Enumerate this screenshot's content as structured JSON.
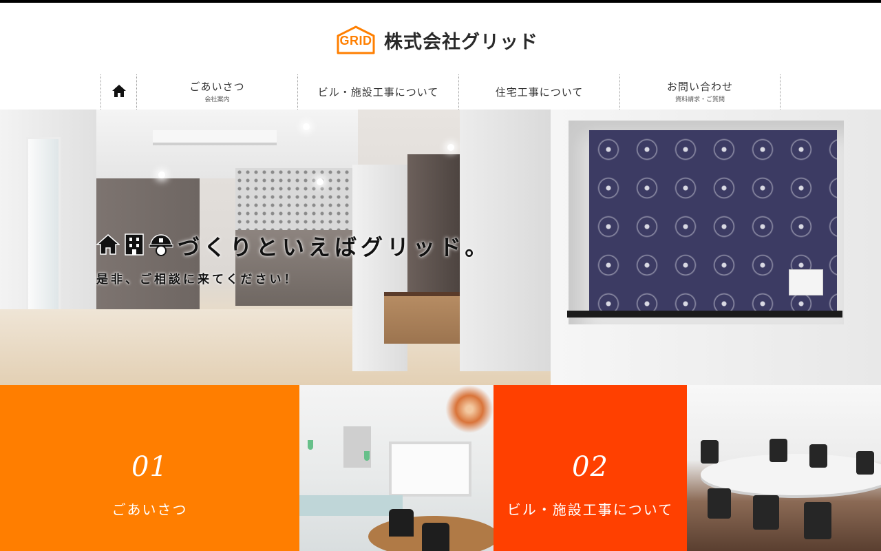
{
  "brand": {
    "logo_mark_text": "GRID",
    "company_name": "株式会社グリッド",
    "accent_color": "#ff7f00"
  },
  "nav": {
    "home_icon": "home-icon",
    "items": [
      {
        "label": "ごあいさつ",
        "sub": "会社案内"
      },
      {
        "label": "ビル・施設工事について",
        "sub": ""
      },
      {
        "label": "住宅工事について",
        "sub": ""
      },
      {
        "label": "お問い合わせ",
        "sub": "資料請求・ご質問"
      }
    ]
  },
  "hero": {
    "icons": [
      "house-icon",
      "building-icon",
      "helmet-icon"
    ],
    "title": "づくりといえばグリッド。",
    "subtitle": "是非、ご相談に来てください！"
  },
  "features": [
    {
      "number": "01",
      "label": "ごあいさつ",
      "color": "#ff7e00"
    },
    {
      "number": "02",
      "label": "ビル・施設工事について",
      "color": "#ff4000"
    }
  ]
}
